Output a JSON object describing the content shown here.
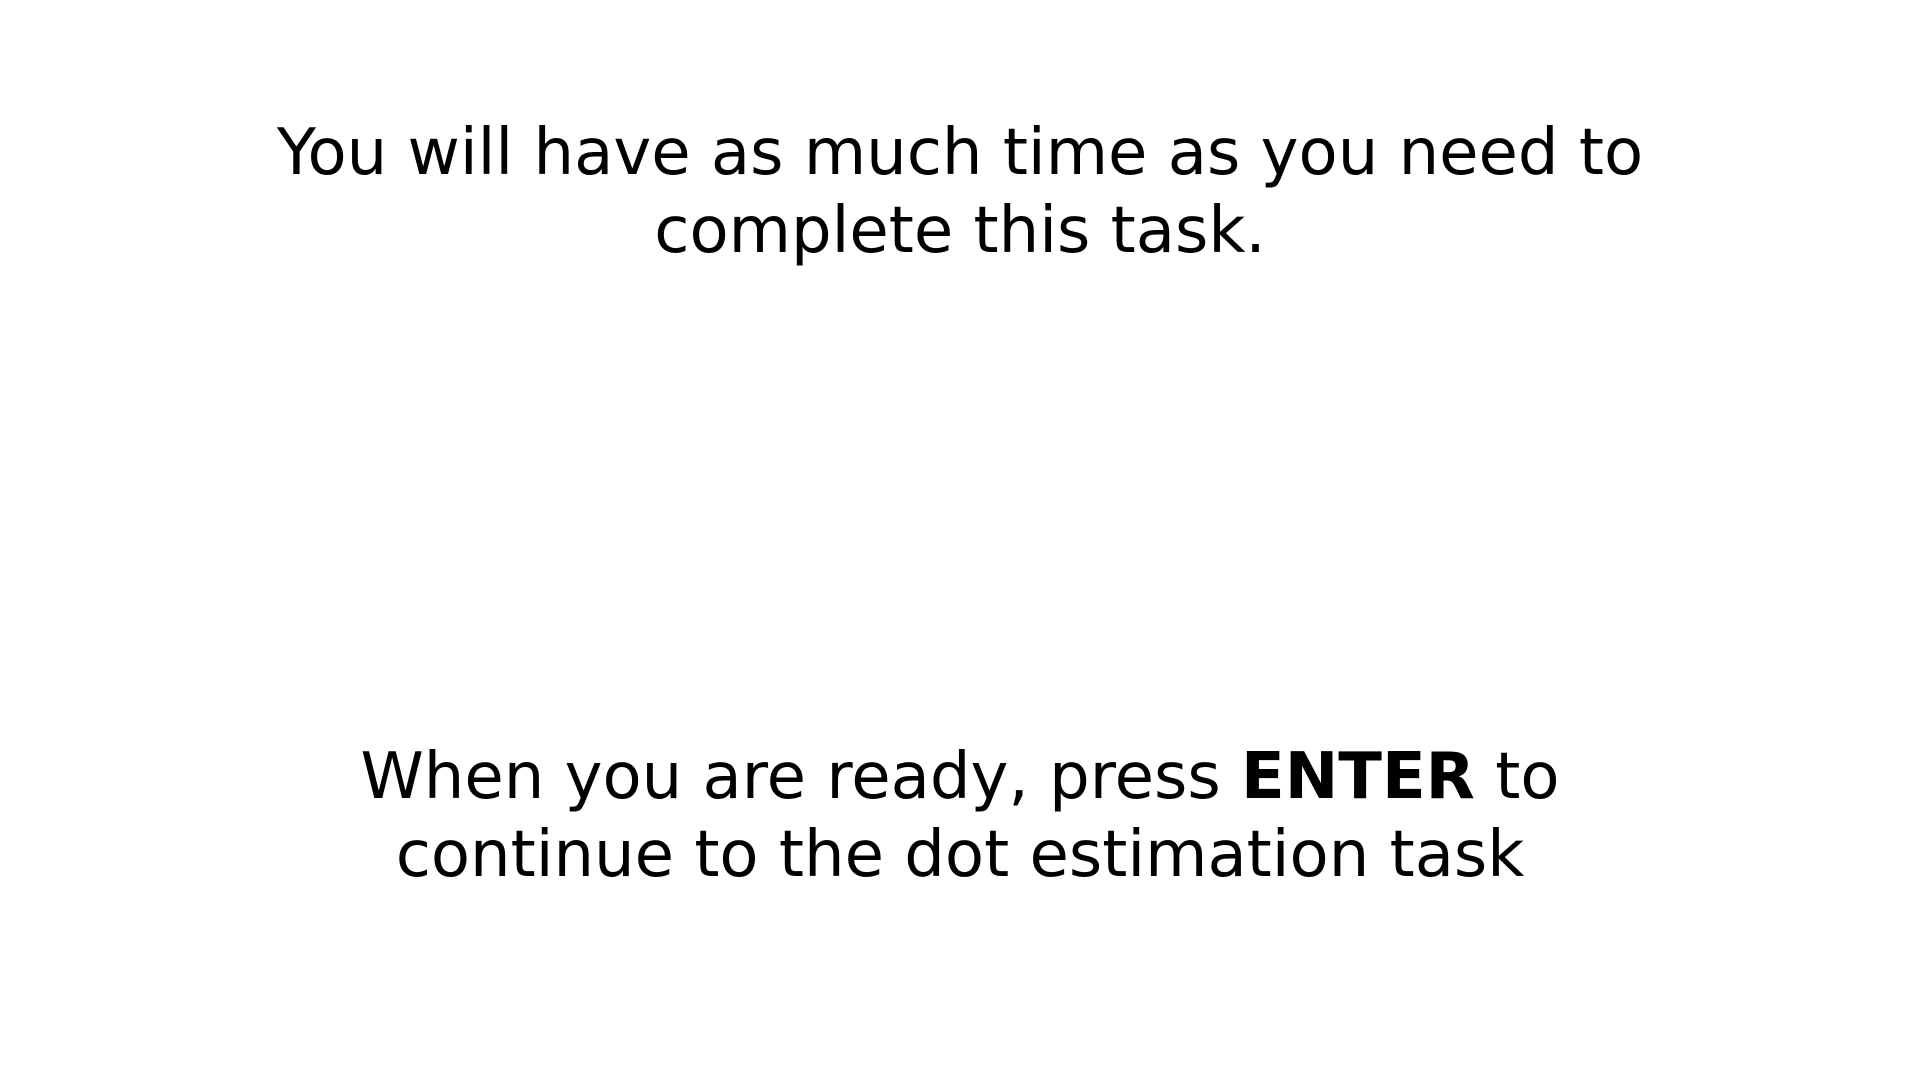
{
  "instructions": {
    "time_message": {
      "line1": "You will have as much time as you need to",
      "line2": "complete this task."
    },
    "continue_message": {
      "line1_before": "When you are ready, press ",
      "key": "ENTER",
      "line1_after": " to",
      "line2": "continue to the dot estimation task"
    }
  },
  "colors": {
    "background": "#ffffff",
    "text": "#000000"
  }
}
